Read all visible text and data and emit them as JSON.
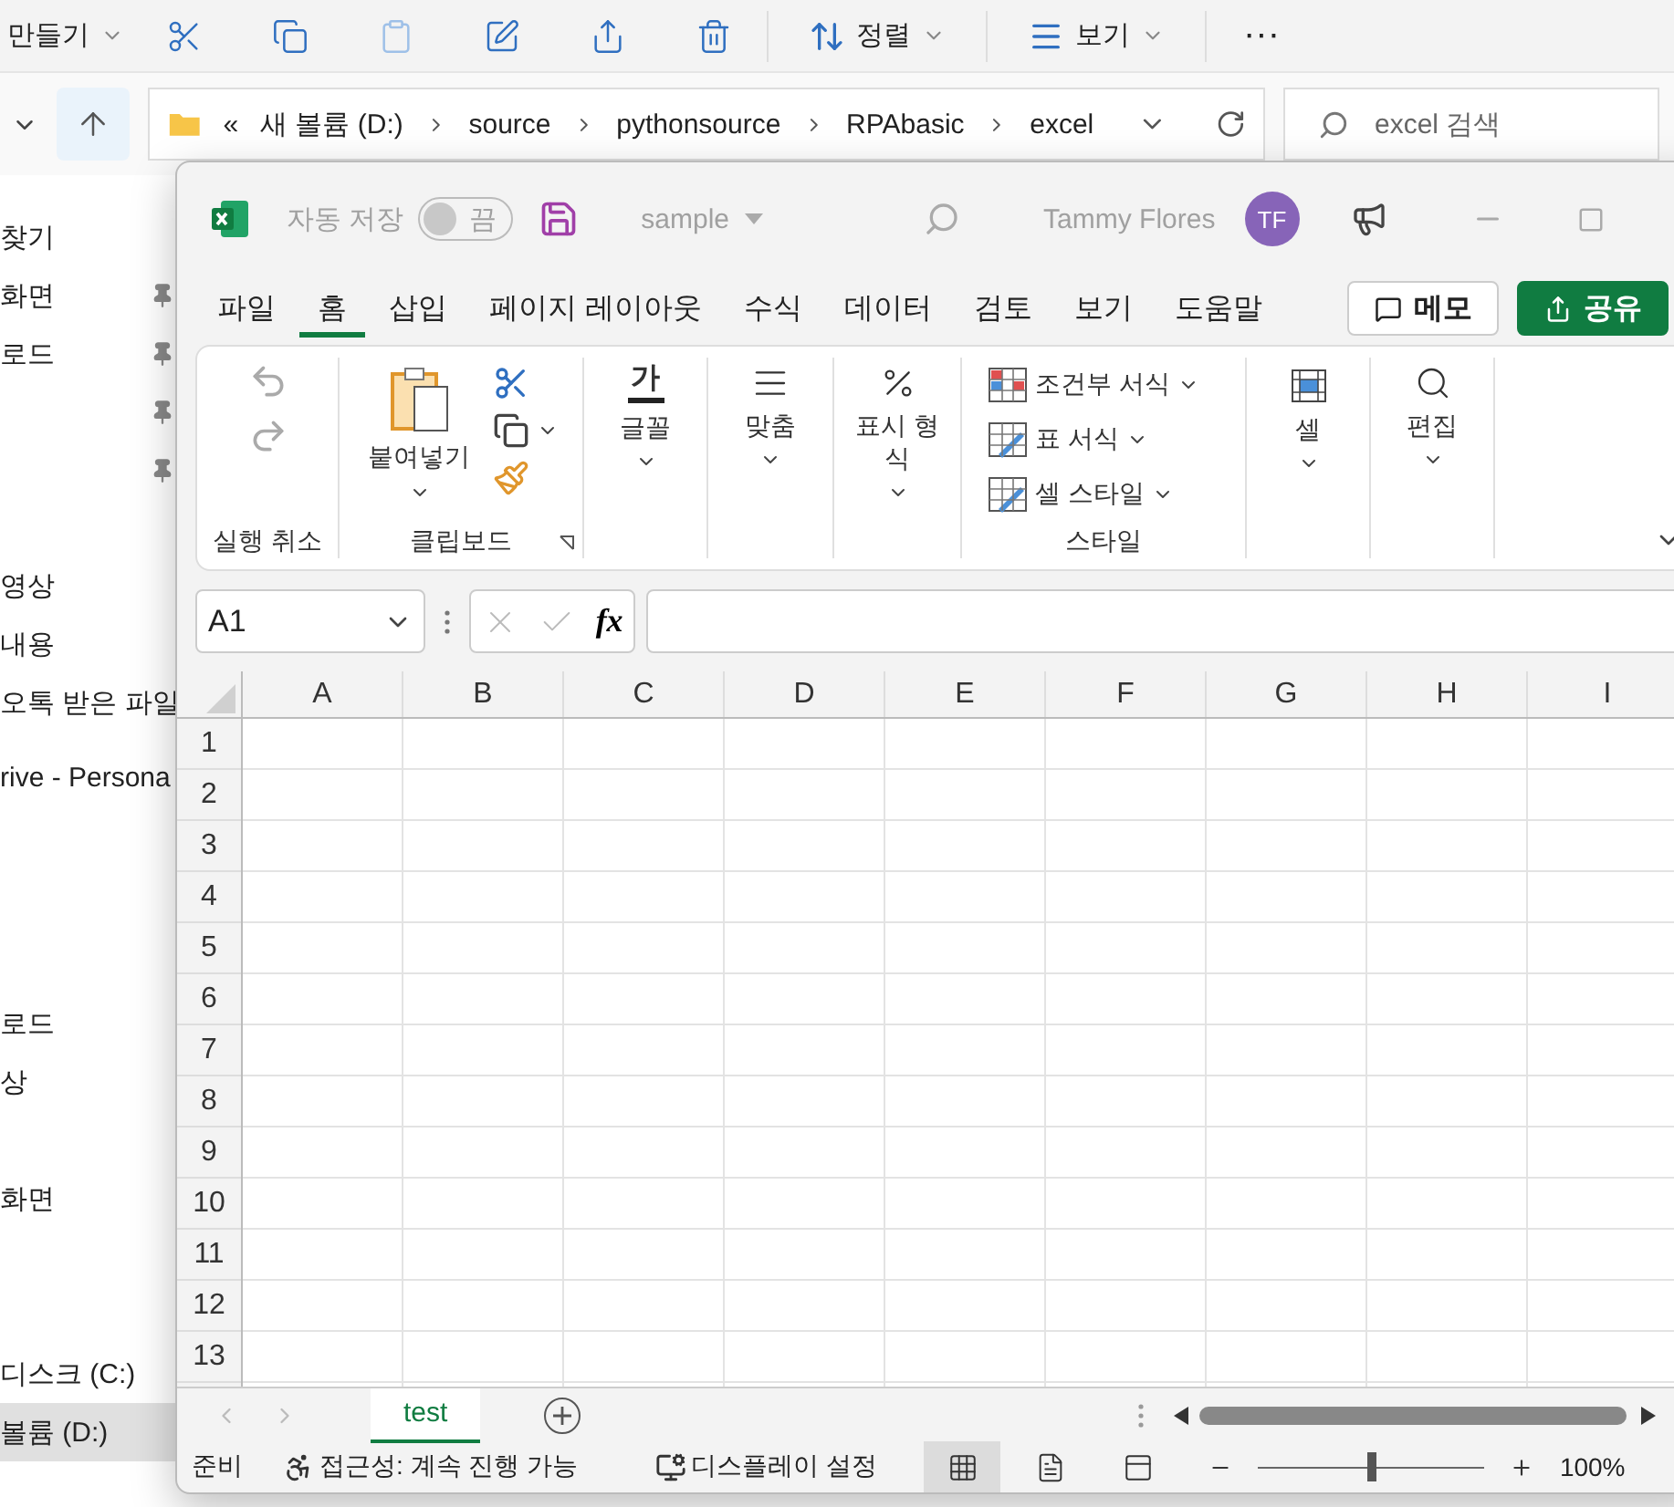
{
  "explorer": {
    "toolbar": [
      {
        "kind": "new",
        "label": "만들기",
        "disabled": false
      },
      {
        "kind": "cut",
        "disabled": false
      },
      {
        "kind": "copy",
        "disabled": false
      },
      {
        "kind": "paste",
        "disabled": true
      },
      {
        "kind": "rename",
        "disabled": false
      },
      {
        "kind": "share",
        "disabled": false
      },
      {
        "kind": "delete",
        "disabled": false
      },
      {
        "kind": "sort",
        "label": "정렬",
        "disabled": false
      },
      {
        "kind": "view",
        "label": "보기",
        "disabled": false
      },
      {
        "kind": "more",
        "label": "···",
        "disabled": false
      }
    ],
    "address": {
      "path": [
        "«",
        "새 볼륨 (D:)",
        "source",
        "pythonsource",
        "RPAbasic",
        "excel"
      ]
    },
    "search": {
      "placeholder": "excel 검색"
    },
    "sidebar": [
      {
        "items": [
          {
            "label": "찾기",
            "pinned": false,
            "selected": false
          },
          {
            "label": "화면",
            "pinned": true,
            "selected": false
          },
          {
            "label": "로드",
            "pinned": true,
            "selected": false
          },
          {
            "pinned": true,
            "selected": false
          },
          {
            "pinned": true,
            "selected": false
          }
        ]
      },
      {
        "items": [
          {
            "label": "영상",
            "pinned": false,
            "selected": false
          },
          {
            "label": "내용",
            "pinned": false,
            "selected": false
          },
          {
            "label": "오톡 받은 파일",
            "pinned": false,
            "selected": false
          }
        ]
      },
      {
        "items": [
          {
            "label": "rive - Persona",
            "pinned": false,
            "selected": false
          }
        ]
      },
      {
        "items": [
          {
            "label": "로드",
            "pinned": false,
            "selected": false
          },
          {
            "label": "상",
            "pinned": false,
            "selected": false
          }
        ]
      },
      {
        "items": [
          {
            "label": "화면",
            "pinned": false,
            "selected": false
          }
        ]
      },
      {
        "items": [
          {
            "label": "디스크 (C:)",
            "pinned": false,
            "selected": false
          },
          {
            "label": "볼륨 (D:)",
            "pinned": false,
            "selected": true
          }
        ]
      }
    ]
  },
  "excel": {
    "title_bar": {
      "autosave_label": "자동 저장",
      "autosave": {
        "on": false,
        "label": "끔"
      },
      "file_name": "sample",
      "user": "Tammy Flores",
      "initials": "TF"
    },
    "tabs": [
      {
        "label": "파일",
        "selected": false
      },
      {
        "label": "홈",
        "selected": true
      },
      {
        "label": "삽입",
        "selected": false
      },
      {
        "label": "페이지 레이아웃",
        "selected": false
      },
      {
        "label": "수식",
        "selected": false
      },
      {
        "label": "데이터",
        "selected": false
      },
      {
        "label": "검토",
        "selected": false
      },
      {
        "label": "보기",
        "selected": false
      },
      {
        "label": "도움말",
        "selected": false
      }
    ],
    "actions": [
      {
        "kind": "comment",
        "label": "메모"
      },
      {
        "kind": "share",
        "label": "공유"
      }
    ],
    "ribbon": {
      "undo_group": "실행 취소",
      "clipboard": {
        "paste": "붙여넣기",
        "group": "클립보드"
      },
      "big_buttons_a": [
        {
          "kind": "font",
          "glyph": "가",
          "label": "글꼴"
        },
        {
          "kind": "align",
          "label": "맞춤"
        },
        {
          "kind": "number",
          "label": "표시 형식"
        }
      ],
      "styles": {
        "items": [
          {
            "kind": "conditional",
            "label": "조건부 서식"
          },
          {
            "kind": "table",
            "label": "표 서식"
          },
          {
            "kind": "cell",
            "label": "셀 스타일"
          }
        ],
        "group": "스타일"
      },
      "big_buttons_b": [
        {
          "kind": "cells",
          "label": "셀"
        },
        {
          "kind": "edit",
          "label": "편집"
        }
      ]
    },
    "formula_bar": {
      "name_box": "A1",
      "fx": "fx"
    },
    "columns": [
      "A",
      "B",
      "C",
      "D",
      "E",
      "F",
      "G",
      "H",
      "I"
    ],
    "rows": [
      "1",
      "2",
      "3",
      "4",
      "5",
      "6",
      "7",
      "8",
      "9",
      "10",
      "11",
      "12",
      "13"
    ],
    "sheets": [
      {
        "label": "test",
        "selected": true
      }
    ],
    "status_bar": {
      "ready": "준비",
      "accessibility": "접근성: 계속 진행 가능",
      "display": "디스플레이 설정",
      "views": [
        {
          "kind": "normal",
          "selected": true
        },
        {
          "kind": "page_layout",
          "selected": false
        },
        {
          "kind": "page_break",
          "selected": false
        }
      ],
      "zoom": {
        "level": 0.5,
        "reading": "100%"
      }
    }
  }
}
